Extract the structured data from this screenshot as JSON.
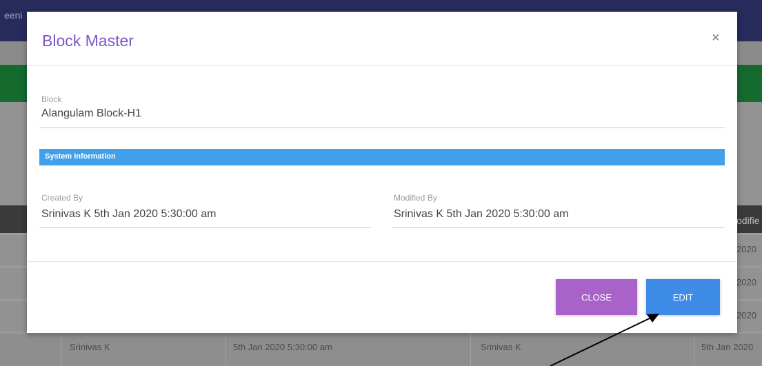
{
  "background": {
    "topbar_fragment": "eeni",
    "header_fragment": "odifie",
    "row_dates": [
      "2020",
      "2020",
      "2020"
    ],
    "last_row": {
      "created_by": "Srinivas K",
      "created_on": "5th Jan 2020 5:30:00 am",
      "modified_by": "Srinivas K",
      "modified_on": "5th Jan 2020"
    }
  },
  "modal": {
    "title": "Block Master",
    "close_symbol": "×",
    "block": {
      "label": "Block",
      "value": "Alangulam Block-H1"
    },
    "system_info": {
      "heading": "System Information",
      "created_by": {
        "label": "Created By",
        "value": "Srinivas K  5th Jan 2020 5:30:00 am"
      },
      "modified_by": {
        "label": "Modified By",
        "value": "Srinivas K  5th Jan 2020 5:30:00 am"
      }
    },
    "buttons": {
      "close_label": "CLOSE",
      "edit_label": "EDIT"
    }
  },
  "colors": {
    "title": "#7e56c7",
    "section_bar": "#42a0ea",
    "close_button": "#a862c9",
    "edit_button": "#3f8ce8"
  },
  "icons": [
    "close-icon",
    "arrow-annotation"
  ]
}
